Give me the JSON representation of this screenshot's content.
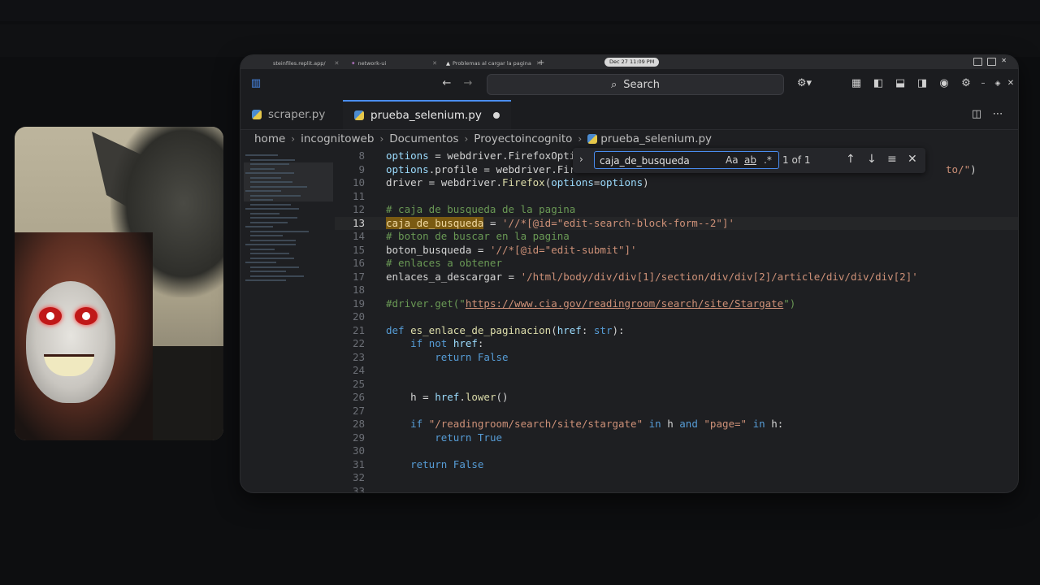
{
  "browser": {
    "tabs": [
      {
        "title": "steinfiles.replit.app/"
      },
      {
        "title": "network-ui"
      },
      {
        "title": "Problemas al cargar la pagina"
      }
    ],
    "new_tab": "+",
    "clock": "Dec 27  11:09 PM"
  },
  "toolbar": {
    "search_label": "Search"
  },
  "editor_tabs": [
    {
      "label": "scraper.py",
      "active": false
    },
    {
      "label": "prueba_selenium.py",
      "active": true,
      "modified": true
    }
  ],
  "breadcrumb": [
    "home",
    "incognitoweb",
    "Documentos",
    "Proyectoincognito",
    "prueba_selenium.py"
  ],
  "find": {
    "query": "caja_de_busqueda",
    "match_case": "Aa",
    "whole_word": "ab",
    "regex": ".*",
    "count": "1 of 1"
  },
  "code_lines": [
    {
      "n": "8",
      "text": "options = webdriver.FirefoxOpti"
    },
    {
      "n": "9",
      "text": "options.profile = webdriver.Fire",
      "tail": "to/\")"
    },
    {
      "n": "10",
      "text": "driver = webdriver.Firefox(options=options)"
    },
    {
      "n": "11",
      "text": ""
    },
    {
      "n": "12",
      "text": "# caja de busqueda de la pagina"
    },
    {
      "n": "13",
      "text": "caja_de_busqueda = '//*[@id=\"edit-search-block-form--2\"]'"
    },
    {
      "n": "14",
      "text": "# boton de buscar en la pagina"
    },
    {
      "n": "15",
      "text": "boton_busqueda = '//*[@id=\"edit-submit\"]'"
    },
    {
      "n": "16",
      "text": "# enlaces a obtener"
    },
    {
      "n": "17",
      "text": "enlaces_a_descargar = '/html/body/div/div[1]/section/div/div[2]/article/div/div/div[2]'"
    },
    {
      "n": "18",
      "text": ""
    },
    {
      "n": "19",
      "text": "#driver.get(\"https://www.cia.gov/readingroom/search/site/Stargate\")"
    },
    {
      "n": "20",
      "text": ""
    },
    {
      "n": "21",
      "text": "def es_enlace_de_paginacion(href: str):"
    },
    {
      "n": "22",
      "text": "    if not href:"
    },
    {
      "n": "23",
      "text": "        return False"
    },
    {
      "n": "24",
      "text": ""
    },
    {
      "n": "25",
      "text": ""
    },
    {
      "n": "26",
      "text": "    h = href.lower()"
    },
    {
      "n": "27",
      "text": ""
    },
    {
      "n": "28",
      "text": "    if \"/readingroom/search/site/stargate\" in h and \"page=\" in h:"
    },
    {
      "n": "29",
      "text": "        return True"
    },
    {
      "n": "30",
      "text": ""
    },
    {
      "n": "31",
      "text": "    return False"
    },
    {
      "n": "32",
      "text": ""
    },
    {
      "n": "33",
      "text": ""
    }
  ],
  "colors": {
    "accent": "#4a8df0",
    "match_highlight": "#7a5a12",
    "comment": "#6a9955",
    "string": "#ce9178",
    "keyword": "#569cd6"
  }
}
